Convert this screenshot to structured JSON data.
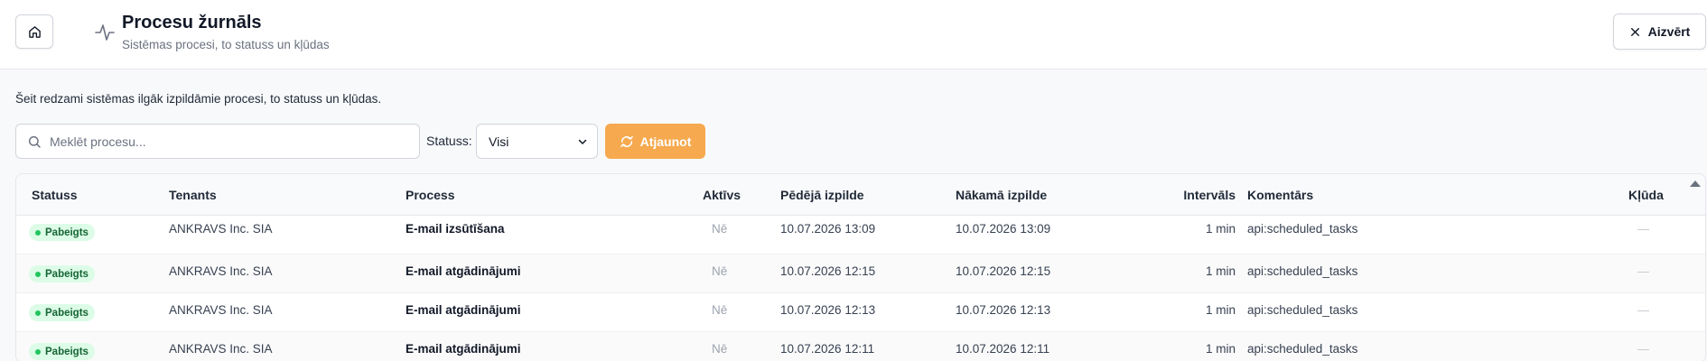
{
  "header": {
    "title": "Procesu žurnāls",
    "subtitle": "Sistēmas procesi, to statuss un kļūdas",
    "close_label": "Aizvērt",
    "home_icon": "home-icon",
    "title_icon": "activity-pulse-icon"
  },
  "intro_text": "Šeit redzami sistēmas ilgāk izpildāmie procesi, to statuss un kļūdas.",
  "filters": {
    "search_placeholder": "Meklēt procesu...",
    "search_value": "",
    "status_label": "Statuss:",
    "status_selected": "Visi",
    "refresh_label": "Atjaunot"
  },
  "colors": {
    "accent": "#f6a94e",
    "status_done_bg": "#dcfce7",
    "status_done_text": "#166534",
    "status_done_dot": "#22c55e"
  },
  "table": {
    "columns": {
      "status": "Statuss",
      "tenant": "Tenants",
      "process": "Process",
      "active": "Aktīvs",
      "last_run": "Pēdējā izpilde",
      "next_run": "Nākamā izpilde",
      "interval": "Intervāls",
      "comment": "Komentārs",
      "error": "Kļūda"
    },
    "rows": [
      {
        "status": "Pabeigts",
        "tenant": "ANKRAVS Inc. SIA",
        "process": "E-mail izsūtīšana",
        "active": "Nē",
        "last_run": "10.07.2026 13:09",
        "next_run": "10.07.2026 13:09",
        "interval": "1 min",
        "comment": "api:scheduled_tasks"
      },
      {
        "status": "Pabeigts",
        "tenant": "ANKRAVS Inc. SIA",
        "process": "E-mail atgādinājumi",
        "active": "Nē",
        "last_run": "10.07.2026 12:15",
        "next_run": "10.07.2026 12:15",
        "interval": "1 min",
        "comment": "api:scheduled_tasks"
      },
      {
        "status": "Pabeigts",
        "tenant": "ANKRAVS Inc. SIA",
        "process": "E-mail atgādinājumi",
        "active": "Nē",
        "last_run": "10.07.2026 12:13",
        "next_run": "10.07.2026 12:13",
        "interval": "1 min",
        "comment": "api:scheduled_tasks"
      },
      {
        "status": "Pabeigts",
        "tenant": "ANKRAVS Inc. SIA",
        "process": "E-mail atgādinājumi",
        "active": "Nē",
        "last_run": "10.07.2026 12:11",
        "next_run": "10.07.2026 12:11",
        "interval": "1 min",
        "comment": "api:scheduled_tasks"
      }
    ]
  }
}
